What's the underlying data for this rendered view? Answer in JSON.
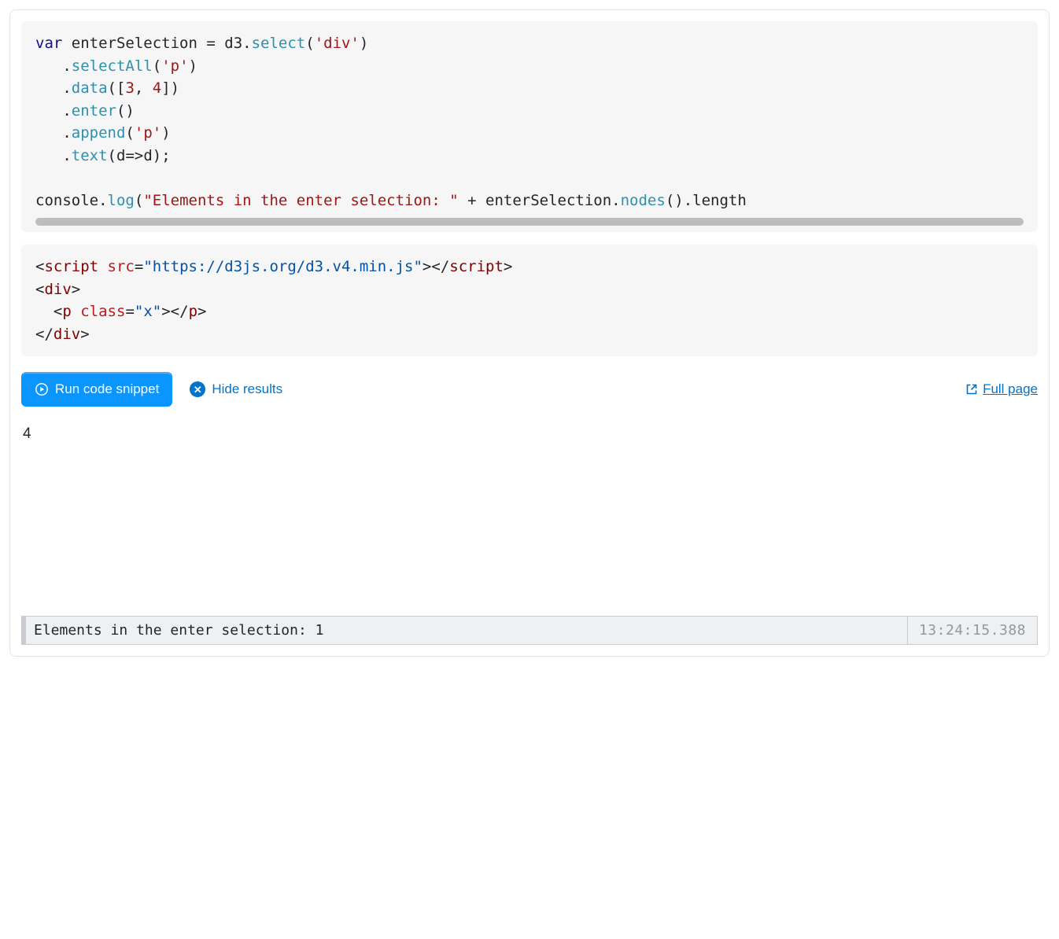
{
  "code_js": {
    "tokens": [
      {
        "t": "var",
        "c": "tok-kw"
      },
      {
        "t": " enterSelection ",
        "c": "tok-id"
      },
      {
        "t": "=",
        "c": "tok-punct"
      },
      {
        "t": " d3",
        "c": "tok-id"
      },
      {
        "t": ".",
        "c": "tok-punct"
      },
      {
        "t": "select",
        "c": "tok-fn"
      },
      {
        "t": "(",
        "c": "tok-punct"
      },
      {
        "t": "'div'",
        "c": "tok-str"
      },
      {
        "t": ")",
        "c": "tok-punct"
      },
      {
        "t": "\n   ",
        "c": "tok-id"
      },
      {
        "t": ".",
        "c": "tok-punct"
      },
      {
        "t": "selectAll",
        "c": "tok-fn"
      },
      {
        "t": "(",
        "c": "tok-punct"
      },
      {
        "t": "'p'",
        "c": "tok-str"
      },
      {
        "t": ")",
        "c": "tok-punct"
      },
      {
        "t": "\n   ",
        "c": "tok-id"
      },
      {
        "t": ".",
        "c": "tok-punct"
      },
      {
        "t": "data",
        "c": "tok-fn"
      },
      {
        "t": "([",
        "c": "tok-punct"
      },
      {
        "t": "3",
        "c": "tok-num"
      },
      {
        "t": ", ",
        "c": "tok-punct"
      },
      {
        "t": "4",
        "c": "tok-num"
      },
      {
        "t": "])",
        "c": "tok-punct"
      },
      {
        "t": "\n   ",
        "c": "tok-id"
      },
      {
        "t": ".",
        "c": "tok-punct"
      },
      {
        "t": "enter",
        "c": "tok-fn"
      },
      {
        "t": "()",
        "c": "tok-punct"
      },
      {
        "t": "\n   ",
        "c": "tok-id"
      },
      {
        "t": ".",
        "c": "tok-punct"
      },
      {
        "t": "append",
        "c": "tok-fn"
      },
      {
        "t": "(",
        "c": "tok-punct"
      },
      {
        "t": "'p'",
        "c": "tok-str"
      },
      {
        "t": ")",
        "c": "tok-punct"
      },
      {
        "t": "\n   ",
        "c": "tok-id"
      },
      {
        "t": ".",
        "c": "tok-punct"
      },
      {
        "t": "text",
        "c": "tok-fn"
      },
      {
        "t": "(d",
        "c": "tok-punct"
      },
      {
        "t": "=>",
        "c": "tok-punct"
      },
      {
        "t": "d);",
        "c": "tok-punct"
      },
      {
        "t": "\n\n",
        "c": "tok-id"
      },
      {
        "t": "console",
        "c": "tok-id"
      },
      {
        "t": ".",
        "c": "tok-punct"
      },
      {
        "t": "log",
        "c": "tok-fn"
      },
      {
        "t": "(",
        "c": "tok-punct"
      },
      {
        "t": "\"Elements in the enter selection: \"",
        "c": "tok-str"
      },
      {
        "t": " + enterSelection",
        "c": "tok-id"
      },
      {
        "t": ".",
        "c": "tok-punct"
      },
      {
        "t": "nodes",
        "c": "tok-fn"
      },
      {
        "t": "()",
        "c": "tok-punct"
      },
      {
        "t": ".",
        "c": "tok-punct"
      },
      {
        "t": "length",
        "c": "tok-id"
      }
    ]
  },
  "code_html": {
    "tokens": [
      {
        "t": "<",
        "c": "tok-punct"
      },
      {
        "t": "script ",
        "c": "tok-tag"
      },
      {
        "t": "src",
        "c": "tok-attr"
      },
      {
        "t": "=",
        "c": "tok-punct"
      },
      {
        "t": "\"https://d3js.org/d3.v4.min.js\"",
        "c": "tok-val"
      },
      {
        "t": ">",
        "c": "tok-punct"
      },
      {
        "t": "</",
        "c": "tok-punct"
      },
      {
        "t": "script",
        "c": "tok-tag"
      },
      {
        "t": ">",
        "c": "tok-punct"
      },
      {
        "t": "\n",
        "c": "tok-id"
      },
      {
        "t": "<",
        "c": "tok-punct"
      },
      {
        "t": "div",
        "c": "tok-tag"
      },
      {
        "t": ">",
        "c": "tok-punct"
      },
      {
        "t": "\n  ",
        "c": "tok-id"
      },
      {
        "t": "<",
        "c": "tok-punct"
      },
      {
        "t": "p ",
        "c": "tok-tag"
      },
      {
        "t": "class",
        "c": "tok-attr"
      },
      {
        "t": "=",
        "c": "tok-punct"
      },
      {
        "t": "\"x\"",
        "c": "tok-val"
      },
      {
        "t": ">",
        "c": "tok-punct"
      },
      {
        "t": "</",
        "c": "tok-punct"
      },
      {
        "t": "p",
        "c": "tok-tag"
      },
      {
        "t": ">",
        "c": "tok-punct"
      },
      {
        "t": "\n",
        "c": "tok-id"
      },
      {
        "t": "</",
        "c": "tok-punct"
      },
      {
        "t": "div",
        "c": "tok-tag"
      },
      {
        "t": ">",
        "c": "tok-punct"
      }
    ]
  },
  "actions": {
    "run_label": "Run code snippet",
    "hide_label": "Hide results",
    "fullpage_label": "Full page"
  },
  "result": {
    "output_text": "4"
  },
  "console": {
    "message": "Elements in the enter selection: 1",
    "timestamp": "13:24:15.388"
  }
}
